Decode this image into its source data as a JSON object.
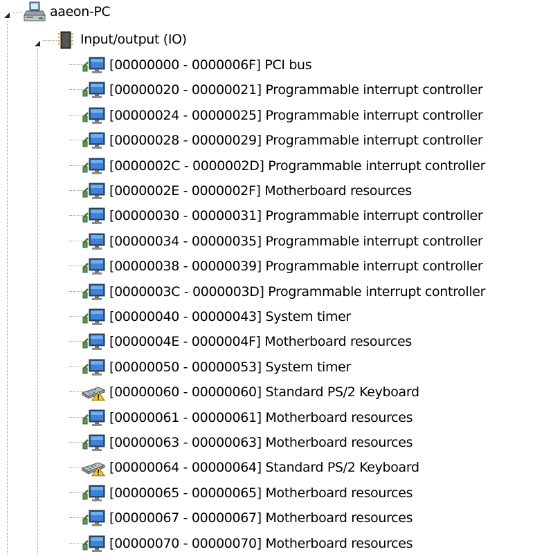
{
  "tree": {
    "root": {
      "label": "aaeon-PC",
      "icon": "computer-icon"
    },
    "category": {
      "label": "Input/output (IO)",
      "icon": "io-chip-icon"
    },
    "items": [
      {
        "label": "[00000000 - 0000006F]  PCI bus",
        "icon": "monitor-device-icon"
      },
      {
        "label": "[00000020 - 00000021]  Programmable interrupt controller",
        "icon": "monitor-device-icon"
      },
      {
        "label": "[00000024 - 00000025]  Programmable interrupt controller",
        "icon": "monitor-device-icon"
      },
      {
        "label": "[00000028 - 00000029]  Programmable interrupt controller",
        "icon": "monitor-device-icon"
      },
      {
        "label": "[0000002C - 0000002D]  Programmable interrupt controller",
        "icon": "monitor-device-icon"
      },
      {
        "label": "[0000002E - 0000002F]  Motherboard resources",
        "icon": "monitor-device-icon"
      },
      {
        "label": "[00000030 - 00000031]  Programmable interrupt controller",
        "icon": "monitor-device-icon"
      },
      {
        "label": "[00000034 - 00000035]  Programmable interrupt controller",
        "icon": "monitor-device-icon"
      },
      {
        "label": "[00000038 - 00000039]  Programmable interrupt controller",
        "icon": "monitor-device-icon"
      },
      {
        "label": "[0000003C - 0000003D]  Programmable interrupt controller",
        "icon": "monitor-device-icon"
      },
      {
        "label": "[00000040 - 00000043]  System timer",
        "icon": "monitor-device-icon"
      },
      {
        "label": "[0000004E - 0000004F]  Motherboard resources",
        "icon": "monitor-device-icon"
      },
      {
        "label": "[00000050 - 00000053]  System timer",
        "icon": "monitor-device-icon"
      },
      {
        "label": "[00000060 - 00000060]  Standard PS/2 Keyboard",
        "icon": "keyboard-warning-icon"
      },
      {
        "label": "[00000061 - 00000061]  Motherboard resources",
        "icon": "monitor-device-icon"
      },
      {
        "label": "[00000063 - 00000063]  Motherboard resources",
        "icon": "monitor-device-icon"
      },
      {
        "label": "[00000064 - 00000064]  Standard PS/2 Keyboard",
        "icon": "keyboard-warning-icon"
      },
      {
        "label": "[00000065 - 00000065]  Motherboard resources",
        "icon": "monitor-device-icon"
      },
      {
        "label": "[00000067 - 00000067]  Motherboard resources",
        "icon": "monitor-device-icon"
      },
      {
        "label": "[00000070 - 00000070]  Motherboard resources",
        "icon": "monitor-device-icon"
      }
    ]
  }
}
